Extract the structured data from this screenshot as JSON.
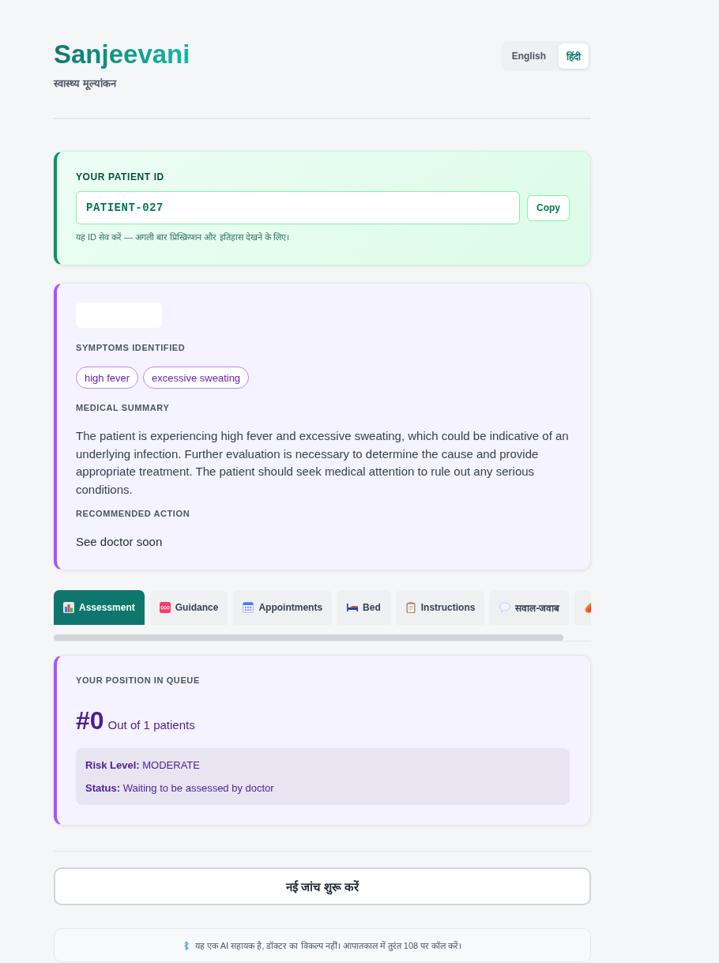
{
  "header": {
    "title": "Sanjeevani",
    "subtitle": "स्वास्थ्य मूल्यांकन",
    "languages": [
      {
        "label": "English",
        "selected": false
      },
      {
        "label": "हिंदी",
        "selected": true
      }
    ]
  },
  "patient_id_card": {
    "label": "YOUR PATIENT ID",
    "value": "PATIENT-027",
    "copy_button": "Copy",
    "hint": "यह ID सेव करें — अगली बार प्रिस्क्रिप्शन और इतिहास देखने के लिए।"
  },
  "assessment_card": {
    "symptoms_label": "SYMPTOMS IDENTIFIED",
    "symptoms": [
      "high fever",
      "excessive sweating"
    ],
    "summary_label": "MEDICAL SUMMARY",
    "summary": "The patient is experiencing high fever and excessive sweating, which could be indicative of an underlying infection. Further evaluation is necessary to determine the cause and provide appropriate treatment. The patient should seek medical attention to rule out any serious conditions.",
    "action_label": "RECOMMENDED ACTION",
    "action": "See doctor soon"
  },
  "tabs": [
    {
      "label": "Assessment",
      "selected": true
    },
    {
      "label": "Guidance",
      "selected": false
    },
    {
      "label": "Appointments",
      "selected": false
    },
    {
      "label": "Bed",
      "selected": false
    },
    {
      "label": "Instructions",
      "selected": false
    },
    {
      "label": "सवाल-जवाब",
      "selected": false
    },
    {
      "selected": false
    }
  ],
  "queue_card": {
    "label": "YOUR POSITION IN QUEUE",
    "position": "#0",
    "total": "Out of 1 patients",
    "details": [
      {
        "label": "Risk Level:",
        "value": "MODERATE"
      },
      {
        "label": "Status:",
        "value": "Waiting to be assessed by doctor"
      }
    ]
  },
  "new_check_button": "नई जांच शुरू करें",
  "disclaimer": "यह एक AI सहायक है, डॉक्टर का विकल्प नहीं। आपातकाल में तुरंत 108 पर कॉल करें।"
}
